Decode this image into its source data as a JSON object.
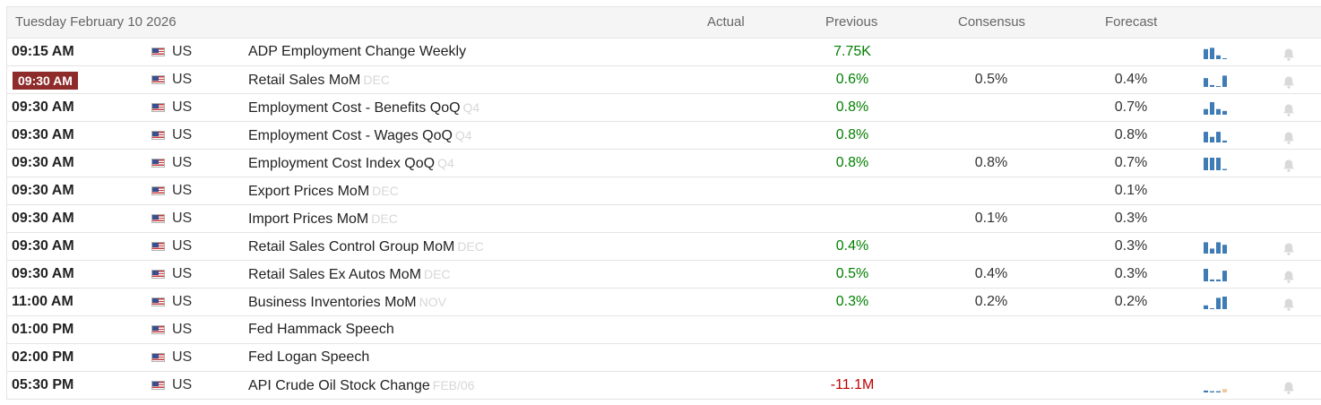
{
  "header": {
    "date": "Tuesday February 10 2026",
    "actual": "Actual",
    "previous": "Previous",
    "consensus": "Consensus",
    "forecast": "Forecast"
  },
  "colors": {
    "active_time_bg": "#8e2b2b",
    "positive": "#008000",
    "negative": "#c00000",
    "spark_bar": "#3f7cb5",
    "spark_alt": "#f2c79a",
    "bell": "#d9d9d9"
  },
  "rows": [
    {
      "time": "09:15 AM",
      "country": "US",
      "event": "ADP Employment Change Weekly",
      "ref": "",
      "previous": "7.75K",
      "consensus": "",
      "forecast": "",
      "spark": [
        0.8,
        0.9,
        0.3,
        0.05
      ],
      "alarm": true,
      "active": false,
      "previous_negative": false
    },
    {
      "time": "09:30 AM",
      "country": "US",
      "event": "Retail Sales MoM",
      "ref": "DEC",
      "previous": "0.6%",
      "consensus": "0.5%",
      "forecast": "0.4%",
      "spark": [
        0.7,
        0.15,
        0.05,
        0.9
      ],
      "alarm": true,
      "active": true,
      "previous_negative": false
    },
    {
      "time": "09:30 AM",
      "country": "US",
      "event": "Employment Cost - Benefits QoQ",
      "ref": "Q4",
      "previous": "0.8%",
      "consensus": "",
      "forecast": "0.7%",
      "spark": [
        0.45,
        1.0,
        0.45,
        0.3
      ],
      "alarm": true,
      "active": false,
      "previous_negative": false
    },
    {
      "time": "09:30 AM",
      "country": "US",
      "event": "Employment Cost - Wages QoQ",
      "ref": "Q4",
      "previous": "0.8%",
      "consensus": "",
      "forecast": "0.8%",
      "spark": [
        0.85,
        0.45,
        0.85,
        0.15
      ],
      "alarm": true,
      "active": false,
      "previous_negative": false
    },
    {
      "time": "09:30 AM",
      "country": "US",
      "event": "Employment Cost Index QoQ",
      "ref": "Q4",
      "previous": "0.8%",
      "consensus": "0.8%",
      "forecast": "0.7%",
      "spark": [
        1.0,
        1.0,
        1.0,
        0.1
      ],
      "alarm": true,
      "active": false,
      "previous_negative": false
    },
    {
      "time": "09:30 AM",
      "country": "US",
      "event": "Export Prices MoM",
      "ref": "DEC",
      "previous": "",
      "consensus": "",
      "forecast": "0.1%",
      "spark": [],
      "alarm": false,
      "active": false,
      "previous_negative": false
    },
    {
      "time": "09:30 AM",
      "country": "US",
      "event": "Import Prices MoM",
      "ref": "DEC",
      "previous": "",
      "consensus": "0.1%",
      "forecast": "0.3%",
      "spark": [],
      "alarm": false,
      "active": false,
      "previous_negative": false
    },
    {
      "time": "09:30 AM",
      "country": "US",
      "event": "Retail Sales Control Group MoM",
      "ref": "DEC",
      "previous": "0.4%",
      "consensus": "",
      "forecast": "0.3%",
      "spark": [
        0.9,
        0.4,
        0.9,
        0.7
      ],
      "alarm": true,
      "active": false,
      "previous_negative": false
    },
    {
      "time": "09:30 AM",
      "country": "US",
      "event": "Retail Sales Ex Autos MoM",
      "ref": "DEC",
      "previous": "0.5%",
      "consensus": "0.4%",
      "forecast": "0.3%",
      "spark": [
        1.0,
        0.15,
        0.15,
        0.85
      ],
      "alarm": true,
      "active": false,
      "previous_negative": false
    },
    {
      "time": "11:00 AM",
      "country": "US",
      "event": "Business Inventories MoM",
      "ref": "NOV",
      "previous": "0.3%",
      "consensus": "0.2%",
      "forecast": "0.2%",
      "spark": [
        0.3,
        0.05,
        0.9,
        1.0
      ],
      "alarm": true,
      "active": false,
      "previous_negative": false
    },
    {
      "time": "01:00 PM",
      "country": "US",
      "event": "Fed Hammack Speech",
      "ref": "",
      "previous": "",
      "consensus": "",
      "forecast": "",
      "spark": [],
      "alarm": false,
      "active": false,
      "previous_negative": false
    },
    {
      "time": "02:00 PM",
      "country": "US",
      "event": "Fed Logan Speech",
      "ref": "",
      "previous": "",
      "consensus": "",
      "forecast": "",
      "spark": [],
      "alarm": false,
      "active": false,
      "previous_negative": false
    },
    {
      "time": "05:30 PM",
      "country": "US",
      "event": "API Crude Oil Stock Change",
      "ref": "FEB/06",
      "previous": "-11.1M",
      "consensus": "",
      "forecast": "",
      "spark": [
        0.15,
        0.1,
        0.1,
        -0.45
      ],
      "alarm": true,
      "active": false,
      "previous_negative": true
    }
  ]
}
